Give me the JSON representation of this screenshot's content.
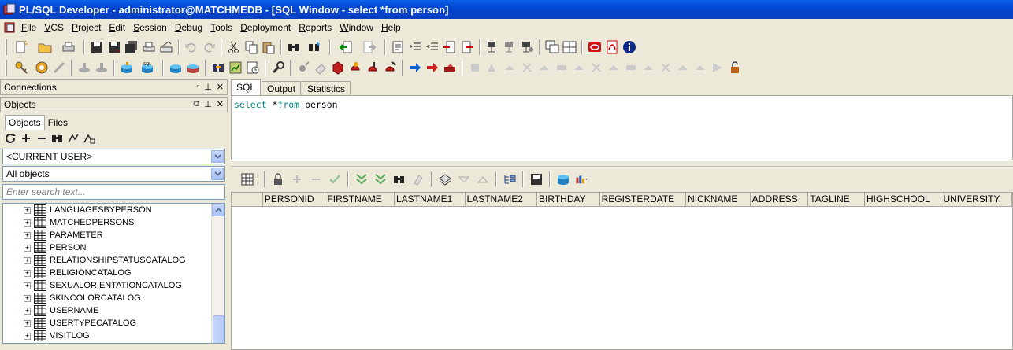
{
  "window": {
    "title": "PL/SQL Developer - administrator@MATCHMEDB - [SQL Window - select *from person]"
  },
  "menu": [
    "File",
    "VCS",
    "Project",
    "Edit",
    "Session",
    "Debug",
    "Tools",
    "Deployment",
    "Reports",
    "Window",
    "Help"
  ],
  "left": {
    "connections_label": "Connections",
    "objects_label": "Objects",
    "tabs": [
      "Objects",
      "Files"
    ],
    "user_combo": "<CURRENT USER>",
    "filter_combo": "All objects",
    "search_placeholder": "Enter search text...",
    "tree_items": [
      "LANGUAGESBYPERSON",
      "MATCHEDPERSONS",
      "PARAMETER",
      "PERSON",
      "RELATIONSHIPSTATUSCATALOG",
      "RELIGIONCATALOG",
      "SEXUALORIENTATIONCATALOG",
      "SKINCOLORCATALOG",
      "USERNAME",
      "USERTYPECATALOG",
      "VISITLOG"
    ]
  },
  "sql": {
    "tabs": [
      "SQL",
      "Output",
      "Statistics"
    ],
    "keyword1": "select",
    "rest": " *",
    "keyword2": "from",
    "table": " person"
  },
  "grid": {
    "columns": [
      "PERSONID",
      "FIRSTNAME",
      "LASTNAME1",
      "LASTNAME2",
      "BIRTHDAY",
      "REGISTERDATE",
      "NICKNAME",
      "ADDRESS",
      "TAGLINE",
      "HIGHSCHOOL",
      "UNIVERSITY"
    ]
  },
  "colors": {
    "titlebar": "#0347d1",
    "chrome": "#ece9d8",
    "keyword": "#008080"
  }
}
